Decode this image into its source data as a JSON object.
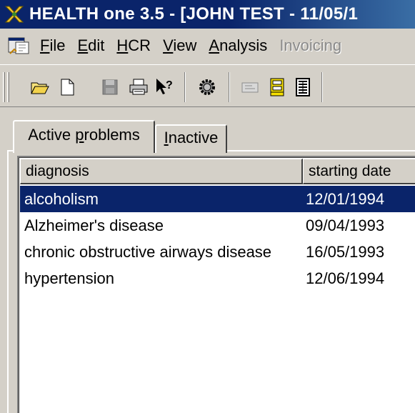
{
  "window": {
    "title": "HEALTH one 3.5 - [JOHN TEST - 11/05/1"
  },
  "menu": {
    "items": [
      {
        "underline": "F",
        "rest": "ile",
        "disabled": false
      },
      {
        "underline": "E",
        "rest": "dit",
        "disabled": false
      },
      {
        "underline": "H",
        "rest": "CR",
        "disabled": false
      },
      {
        "underline": "V",
        "rest": "iew",
        "disabled": false
      },
      {
        "underline": "A",
        "rest": "nalysis",
        "disabled": false
      },
      {
        "underline": "",
        "rest": "Invoicing",
        "disabled": true
      }
    ]
  },
  "toolbar": {
    "icons": [
      "open-folder-icon",
      "new-document-icon",
      "save-icon",
      "print-icon",
      "context-help-icon",
      "settings-gear-icon",
      "card-icon",
      "file-cabinet-icon",
      "calculator-icon"
    ]
  },
  "tabs": {
    "active": {
      "pre": "Active ",
      "underline": "p",
      "post": "roblems"
    },
    "inactive": {
      "pre": "",
      "underline": "I",
      "post": "nactive"
    }
  },
  "list": {
    "columns": [
      "diagnosis",
      "starting date"
    ],
    "rows": [
      {
        "diagnosis": "alcoholism",
        "date": "12/01/1994",
        "selected": true
      },
      {
        "diagnosis": "Alzheimer's disease",
        "date": "09/04/1993",
        "selected": false
      },
      {
        "diagnosis": "chronic obstructive airways disease",
        "date": "16/05/1993",
        "selected": false
      },
      {
        "diagnosis": "hypertension",
        "date": "12/06/1994",
        "selected": false
      }
    ]
  },
  "colors": {
    "title_bar": "#0a246a",
    "selection": "#0a246a",
    "face": "#d4d0c8"
  }
}
